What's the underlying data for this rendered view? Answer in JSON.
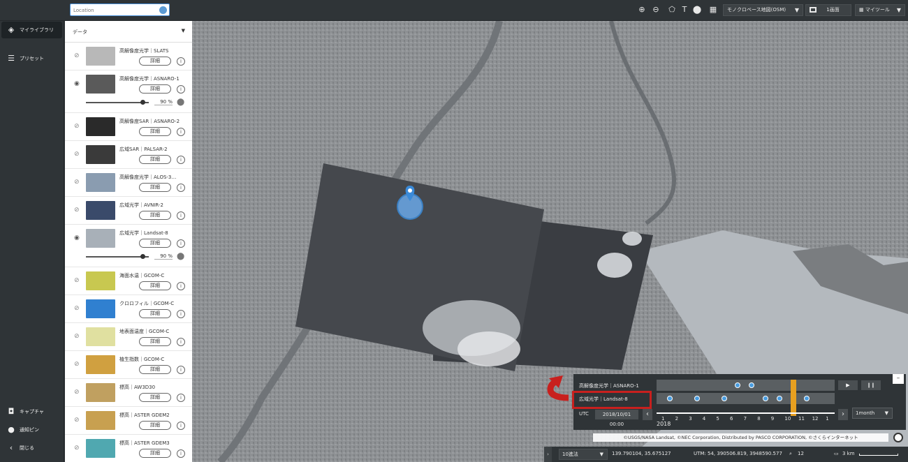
{
  "search": {
    "placeholder": "Location"
  },
  "toolbar": {
    "basemap": "モノクロベース地図(OSM)",
    "screens": "1画面",
    "mytools": "マイツール"
  },
  "nav": {
    "library": "マイライブラリ",
    "preset": "プリセット",
    "capture": "キャプチャ",
    "pin": "通知ピン",
    "close": "閉じる"
  },
  "panel": {
    "title": "データ",
    "detail_label": "詳細",
    "info_label": "i",
    "layers": [
      {
        "name": "高解像度光学｜SLATS",
        "visible": false,
        "thumb": "#b8b8b8"
      },
      {
        "name": "高解像度光学｜ASNARO-1",
        "visible": true,
        "thumb": "#5a5a5a",
        "opacity": "90",
        "opacity_value": 0.9
      },
      {
        "name": "高解像度SAR｜ASNARO-2",
        "visible": false,
        "thumb": "#2a2a2a"
      },
      {
        "name": "広域SAR｜PALSAR-2",
        "visible": false,
        "thumb": "#3a3a3a"
      },
      {
        "name": "高解像度光学｜ALOS-3…",
        "visible": false,
        "thumb": "#8a9cb0"
      },
      {
        "name": "広域光学｜AVNIR-2",
        "visible": false,
        "thumb": "#3a4a6a"
      },
      {
        "name": "広域光学｜Landsat-8",
        "visible": true,
        "thumb": "#a8b0b8",
        "opacity": "90",
        "opacity_value": 0.9
      },
      {
        "name": "海面水温｜GCOM-C",
        "visible": false,
        "thumb": "#c8c850"
      },
      {
        "name": "クロロフィル｜GCOM-C",
        "visible": false,
        "thumb": "#3080d0"
      },
      {
        "name": "地表面温度｜GCOM-C",
        "visible": false,
        "thumb": "#e0e0a0"
      },
      {
        "name": "植生指数｜GCOM-C",
        "visible": false,
        "thumb": "#d0a040"
      },
      {
        "name": "標高｜AW3D30",
        "visible": false,
        "thumb": "#c0a060"
      },
      {
        "name": "標高｜ASTER GDEM2",
        "visible": false,
        "thumb": "#c8a050"
      },
      {
        "name": "標高｜ASTER GDEM3",
        "visible": false,
        "thumb": "#50a8b0"
      }
    ],
    "opacity_unit": "%"
  },
  "timeline": {
    "rows": [
      {
        "label": "高解像度光学｜ASNARO-1"
      },
      {
        "label": "広域光学｜Landsat-8"
      }
    ],
    "utc_label": "UTC",
    "date": "2018/10/01 00:00",
    "months": [
      "1",
      "2",
      "3",
      "4",
      "5",
      "6",
      "7",
      "8",
      "9",
      "10",
      "11",
      "12",
      "1"
    ],
    "year": "2018",
    "interval": "1month",
    "play": "▶",
    "pause": "❙❙",
    "close": "–"
  },
  "attribution": "©USGS/NASA Landsat, ©NEC Corporation, Distributed by PASCO CORPORATION, ©さくらインターネット",
  "status": {
    "format": "10進法",
    "latlon": "139.790104, 35.675127",
    "utm": "UTM: 54, 390506.819, 3948590.577",
    "zoom": "12",
    "scale": "3 km"
  },
  "colors": {
    "accent": "#4a9de0",
    "annotation": "#c8201e",
    "highlight": "#e8a020"
  }
}
